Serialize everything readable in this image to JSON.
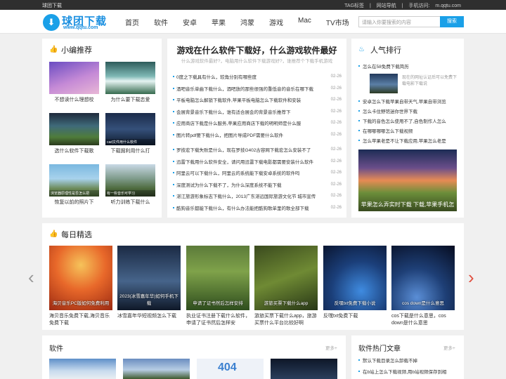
{
  "topbar": {
    "left": "球团下载",
    "links": [
      "TAG标签",
      "|",
      "网站导航",
      "|",
      "手机访问:",
      "m.qqtu.com"
    ]
  },
  "header": {
    "logo_title": "球团下载",
    "logo_url": "www.qqtu.com",
    "nav": [
      "首页",
      "软件",
      "安卓",
      "苹果",
      "鸿蒙",
      "游戏",
      "Mac",
      "TV市场"
    ],
    "search_placeholder": "请输入你要搜索的内容",
    "search_button": "搜索"
  },
  "editor_pick": {
    "title": "小编推荐",
    "items": [
      {
        "caption": "不想读什么理想校",
        "overlay": ""
      },
      {
        "caption": "为什么要下载恋爱",
        "overlay": ""
      },
      {
        "caption": "选什么软件下载歌",
        "overlay": ""
      },
      {
        "caption": "下载掘利用什么打",
        "overlay": "cad文件用什么软件"
      },
      {
        "caption": "恢复以前的照片下",
        "overlay": "浏览器原理性是否怎么把"
      },
      {
        "caption": "听力训练下载什么",
        "overlay": "有一些音乐可学习"
      }
    ]
  },
  "center": {
    "title": "游戏在什么软件下载好，什么游戏软件最好",
    "subtitle": "什么游戏软件最好?，电脑用什么软件下载游戏好?，谁推荐个下载手机游戏",
    "group1": [
      {
        "text": "0度之下载具有什么，较角分别有哪些度",
        "date": "02-26"
      },
      {
        "text": "酒吧音乐单曲下载什么，酒吧放的那些很强的重低音的音乐在哪下载",
        "date": "02-26"
      },
      {
        "text": "平板电脑怎么解锁下载软件,苹果平板电脑怎么下载软件和安装",
        "date": "02-26"
      },
      {
        "text": "会展背景音乐下载什么，谁有适合展会的背景音乐推荐下",
        "date": "02-26"
      },
      {
        "text": "应用商店下载是什么服务,苹果应用商店下载的明明师是什么服",
        "date": "02-26"
      },
      {
        "text": "图片转pdf要下载什么，把图片导成PDF需要什么软件",
        "date": "02-26"
      }
    ],
    "group2": [
      {
        "text": "罗技宏下载失败是什么，现在罗技G402古容网下载宏怎么安装不了",
        "date": "02-26"
      },
      {
        "text": "迅雷下载用什么软件安全，请问用迅雷下载电影都需要安装什么软件",
        "date": "02-26"
      },
      {
        "text": "阿里云可以下载什么，阿里云的系统能下载安卓系统的软件吗",
        "date": "02-26"
      },
      {
        "text": "深度测试为什么下载不了，为什么深度系统不能下载",
        "date": "02-26"
      },
      {
        "text": "湛江旅游形象标志下载什么，2013广东湛远国际旅游文化节 城市宣传",
        "date": "02-26"
      },
      {
        "text": "酷狗音乐都能下载什么，有什么办法能把酷狗歌单里的歌全部下载",
        "date": "02-26"
      }
    ]
  },
  "popular": {
    "title": "人气排行",
    "top_item": "怎么在58免费下载简历",
    "highlight_text": "现在的网址认证后可以免费下载电影下载说",
    "items": [
      "安卓怎么下载苹果自带天气,苹果自带浏览",
      "怎么卡住野馆迷你世界下载",
      "下载的音色怎么使用不了,自色制作人怎么",
      "在哪哪哪哪怎么下载视频",
      "怎么苹果老是不让下载应用,苹果怎么老是"
    ],
    "banner_caption": "苹果怎么弄实时下载 下载,苹果手机怎"
  },
  "daily": {
    "title": "每日精选",
    "items": [
      {
        "caption": "海贝音乐免费下载,海贝音乐免费下载",
        "overlay": "海贝音乐PC版如何免费利用"
      },
      {
        "caption": "冰雪嘉年华短视频怎么下载",
        "overlay": "2023(冰雪嘉年华)如何手机下载"
      },
      {
        "caption": "执业证书注册下载什么软件，申请了证书然后怎样安",
        "overlay": "申请了证书然后怎样安排"
      },
      {
        "caption": "游旅买票下载什么app，旅游买票什么平台比较好啊",
        "overlay": "游旅买票下载什么app"
      },
      {
        "caption": "反嘿txt免费下载",
        "overlay": "反嘿txt免费下载小说"
      },
      {
        "caption": "cos下载是什么意思，cos down是什么意思",
        "overlay": "cos down是什么意思"
      }
    ]
  },
  "software": {
    "title": "软件",
    "more": "更多+"
  },
  "hot": {
    "title": "软件热门文章",
    "more": "更多+",
    "items": [
      "默认下载目录怎么卸载不掉",
      "在b站上怎么下载视频,用b站视频保存到相"
    ]
  }
}
